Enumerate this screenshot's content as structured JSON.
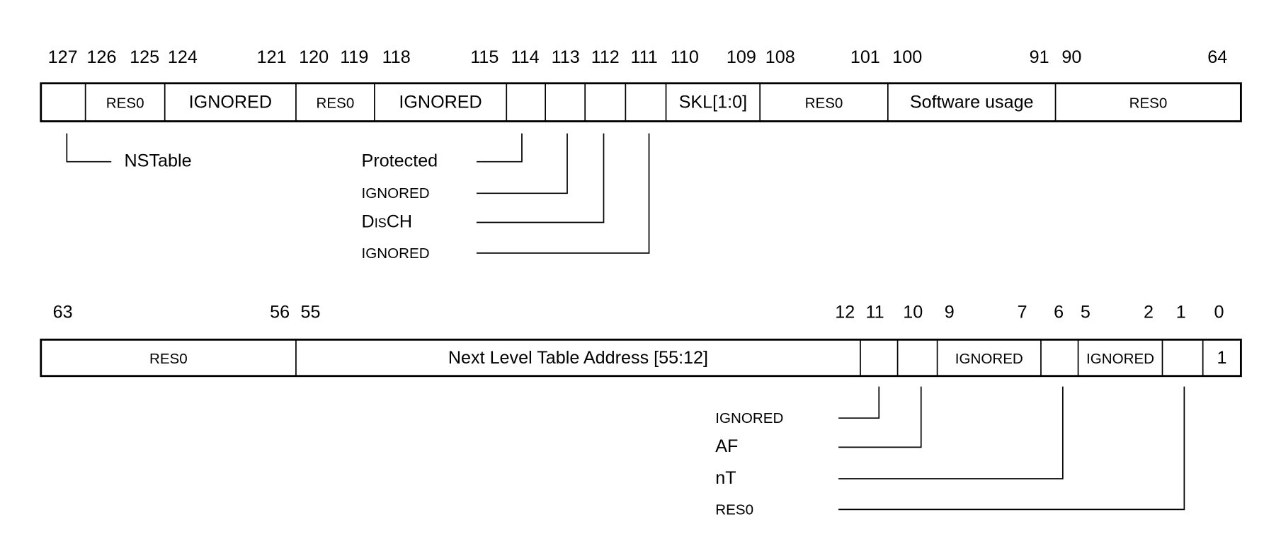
{
  "upper_word": {
    "bit_ticks": [
      "127",
      "126",
      "125",
      "124",
      "121",
      "120",
      "119",
      "118",
      "115",
      "114",
      "113",
      "112",
      "111",
      "110",
      "109",
      "108",
      "101",
      "100",
      "91",
      "90",
      "64"
    ],
    "fields": [
      "",
      "RES0",
      "IGNORED",
      "RES0",
      "IGNORED",
      "",
      "",
      "",
      "",
      "SKL[1:0]",
      "RES0",
      "Software usage",
      "RES0"
    ],
    "annotations": [
      "NSTable",
      "Protected",
      "IGNORED",
      "DisCH",
      "IGNORED"
    ]
  },
  "lower_word": {
    "bit_ticks": [
      "63",
      "56",
      "55",
      "12",
      "11",
      "10",
      "9",
      "7",
      "6",
      "5",
      "2",
      "1",
      "0"
    ],
    "fields": [
      "RES0",
      "Next Level Table Address [55:12]",
      "",
      "",
      "IGNORED",
      "",
      "IGNORED",
      "",
      "1"
    ],
    "annotations": [
      "IGNORED",
      "AF",
      "nT",
      "RES0"
    ]
  }
}
